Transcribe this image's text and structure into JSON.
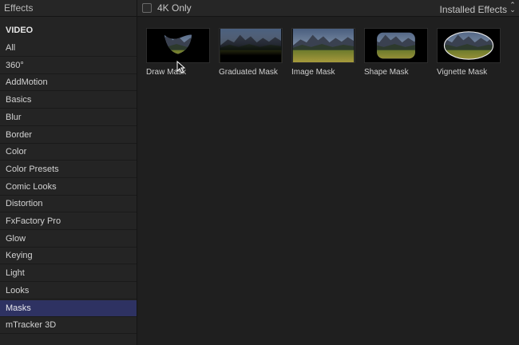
{
  "panel_title": "Effects",
  "toolbar": {
    "filter_label": "4K Only",
    "filter_checked": false,
    "source_select": "Installed Effects",
    "source_select_icon": "up-down-chevron-icon"
  },
  "sidebar": {
    "section_header": "VIDEO",
    "items": [
      {
        "label": "All"
      },
      {
        "label": "360°"
      },
      {
        "label": "AddMotion"
      },
      {
        "label": "Basics"
      },
      {
        "label": "Blur"
      },
      {
        "label": "Border"
      },
      {
        "label": "Color"
      },
      {
        "label": "Color Presets"
      },
      {
        "label": "Comic Looks"
      },
      {
        "label": "Distortion"
      },
      {
        "label": "FxFactory Pro"
      },
      {
        "label": "Glow"
      },
      {
        "label": "Keying"
      },
      {
        "label": "Light"
      },
      {
        "label": "Looks"
      },
      {
        "label": "Masks",
        "selected": true
      },
      {
        "label": "mTracker 3D"
      }
    ]
  },
  "effects": [
    {
      "label": "Draw Mask"
    },
    {
      "label": "Graduated Mask"
    },
    {
      "label": "Image Mask"
    },
    {
      "label": "Shape Mask"
    },
    {
      "label": "Vignette Mask"
    }
  ],
  "colors": {
    "selection": "#2e3262",
    "background": "#1f1f1f",
    "sidebar": "#242424"
  }
}
